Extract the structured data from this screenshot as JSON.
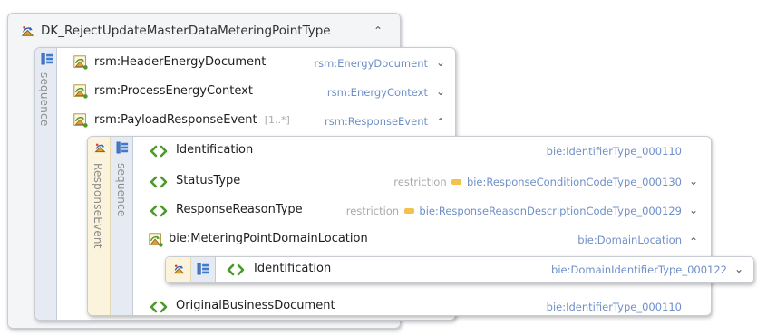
{
  "root": {
    "title": "DK_RejectUpdateMasterDataMeteringPointType",
    "sequence_label": "sequence",
    "items": [
      {
        "name": "rsm:HeaderEnergyDocument",
        "type": "rsm:EnergyDocument"
      },
      {
        "name": "rsm:ProcessEnergyContext",
        "type": "rsm:EnergyContext"
      },
      {
        "name": "rsm:PayloadResponseEvent",
        "cardinality": "[1..*]",
        "type": "rsm:ResponseEvent"
      }
    ]
  },
  "response_event": {
    "group_label": "ResponseEvent",
    "sequence_label": "sequence",
    "items": [
      {
        "name": "Identification",
        "type": "bie:IdentifierType_000110"
      },
      {
        "name": "StatusType",
        "restriction": "restriction",
        "type": "bie:ResponseConditionCodeType_000130"
      },
      {
        "name": "ResponseReasonType",
        "restriction": "restriction",
        "type": "bie:ResponseReasonDescriptionCodeType_000129"
      },
      {
        "name": "bie:MeteringPointDomainLocation",
        "type": "bie:DomainLocation"
      },
      {
        "name": "OriginalBusinessDocument",
        "type": "bie:IdentifierType_000110"
      }
    ]
  },
  "domain_location": {
    "items": [
      {
        "name": "Identification",
        "type": "bie:DomainIdentifierType_000122"
      }
    ]
  },
  "colors": {
    "element_icon": "#4b9a2a",
    "type_text": "#6f8fc9",
    "sequence_bar": "#e6ebf3",
    "group_bar": "#fbf3dc"
  }
}
